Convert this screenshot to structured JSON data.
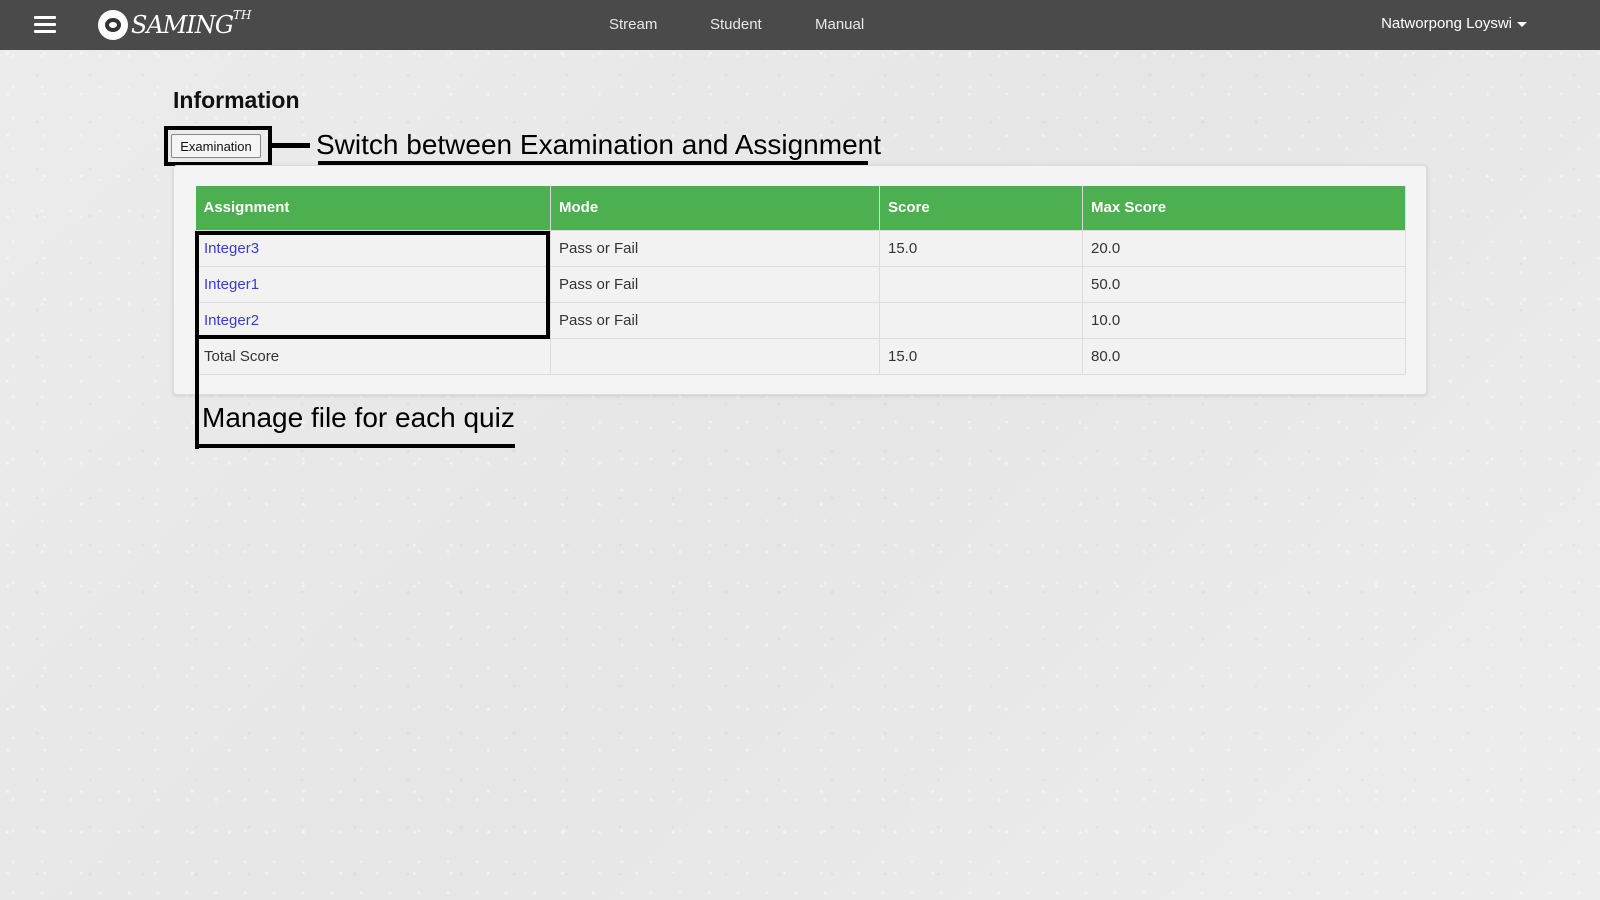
{
  "navbar": {
    "brand_text": "SAMING",
    "brand_sup": "TH",
    "links": [
      "Stream",
      "Student",
      "Manual"
    ],
    "user_name": "Natworpong Loyswi"
  },
  "page": {
    "title": "Information",
    "toggle_button_label": "Examination"
  },
  "annotations": {
    "switch_note": "Switch between Examination and Assignment",
    "manage_note": "Manage file for each quiz"
  },
  "table": {
    "headers": [
      "Assignment",
      "Mode",
      "Score",
      "Max Score"
    ],
    "rows": [
      {
        "assignment": "Integer3",
        "mode": "Pass or Fail",
        "score": "15.0",
        "max_score": "20.0"
      },
      {
        "assignment": "Integer1",
        "mode": "Pass or Fail",
        "score": "",
        "max_score": "50.0"
      },
      {
        "assignment": "Integer2",
        "mode": "Pass or Fail",
        "score": "",
        "max_score": "10.0"
      }
    ],
    "total": {
      "label": "Total Score",
      "mode": "",
      "score": "15.0",
      "max_score": "80.0"
    }
  },
  "colors": {
    "navbar": "#4a4a4a",
    "table_header": "#4caf50",
    "link": "#3b3bd6"
  }
}
